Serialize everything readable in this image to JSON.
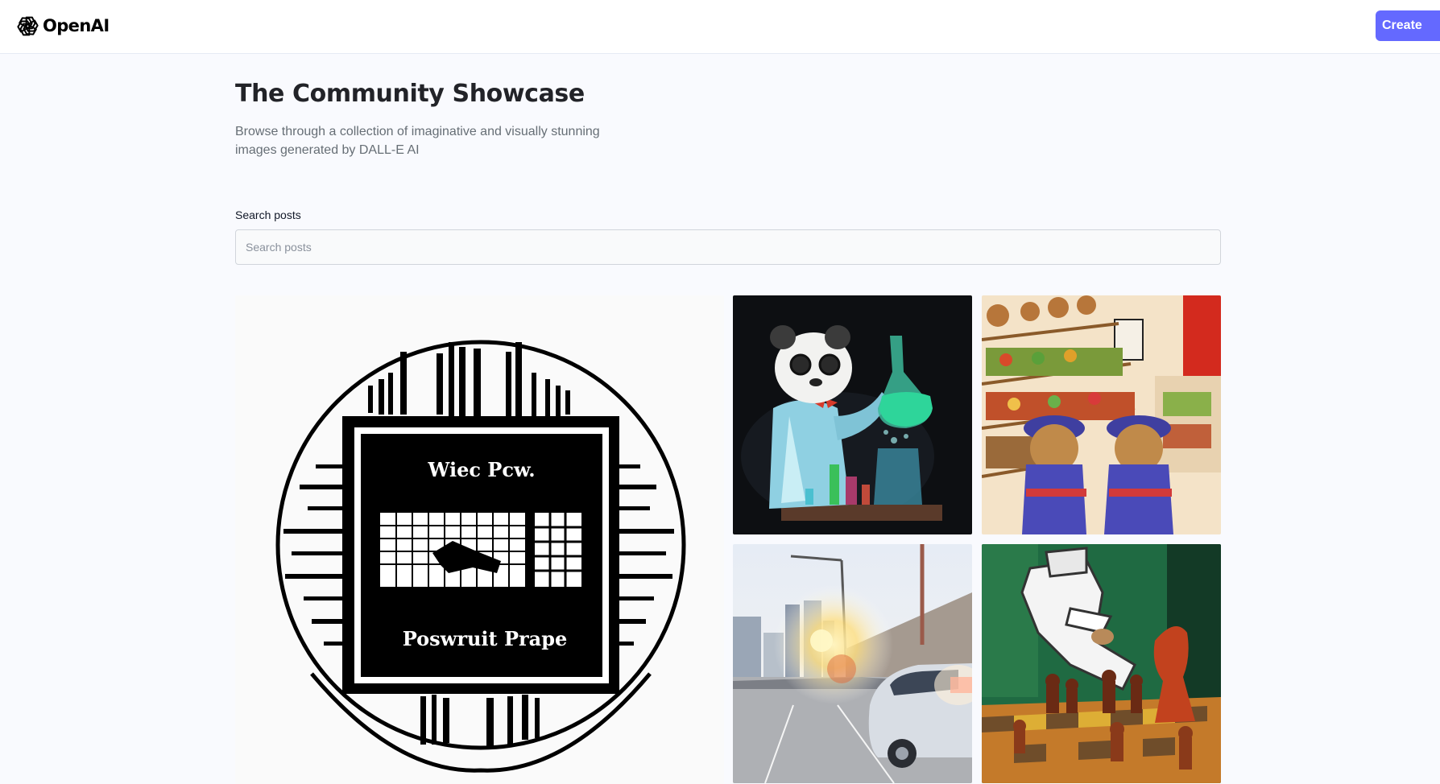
{
  "header": {
    "logo_text": "OpenAI",
    "create_button": "Create"
  },
  "hero": {
    "title": "The Community Showcase",
    "subtitle": "Browse through a collection of imaginative and visually stunning images generated by DALL-E AI"
  },
  "search": {
    "label": "Search posts",
    "placeholder": "Search posts",
    "value": ""
  },
  "gallery": {
    "cards": [
      {
        "id": "card-1",
        "image": "black and white circular logo with keyboard",
        "text_top": "Wiec Pcw.",
        "text_bottom": "Poswruit Prape"
      },
      {
        "id": "card-2",
        "image": "panda scientist pouring green liquid"
      },
      {
        "id": "card-3",
        "image": "teddy bears shopping at a market"
      },
      {
        "id": "card-4",
        "image": "car driving on city highway at sunrise"
      },
      {
        "id": "card-5",
        "image": "abstract chess player painting"
      }
    ]
  },
  "colors": {
    "brand": "#6469ff",
    "background": "#f9fafe",
    "title": "#222328",
    "subtitle": "#666e75"
  }
}
